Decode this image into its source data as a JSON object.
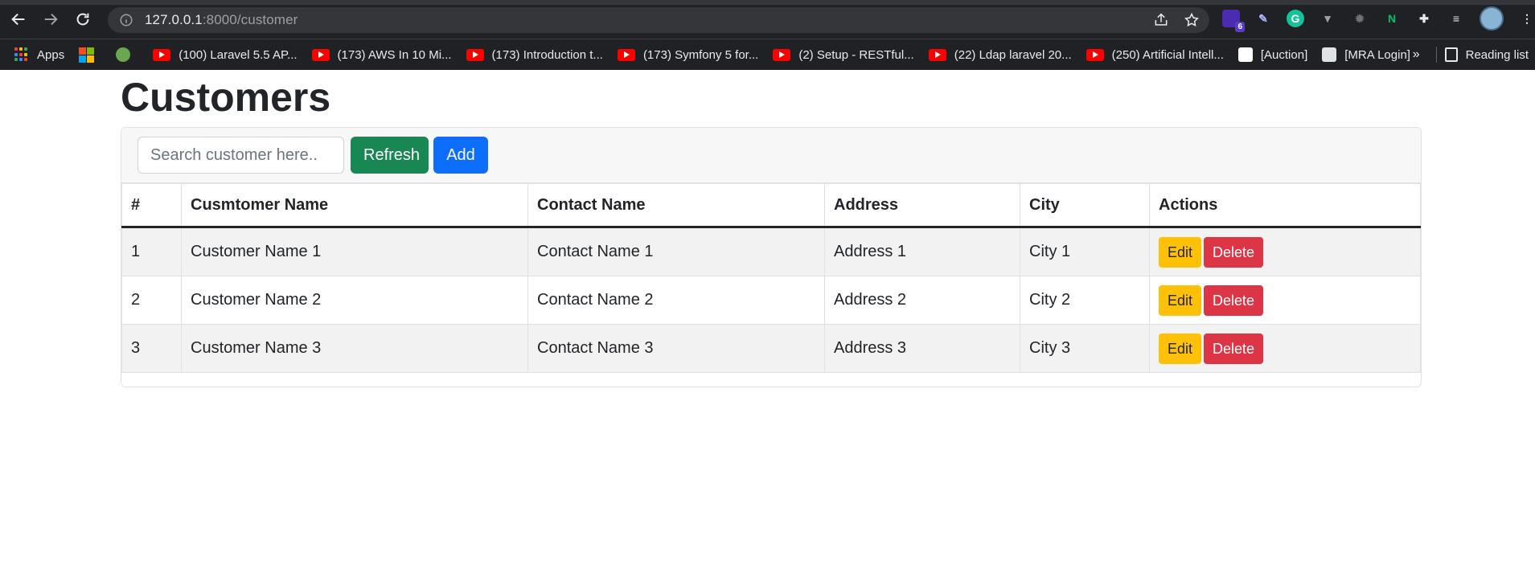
{
  "browser": {
    "url_host": "127.0.0.1",
    "url_path": ":8000/customer",
    "extension_badge": "6",
    "bookmarks": [
      {
        "label": "Apps",
        "icon": "apps-grid-icon"
      },
      {
        "label": "",
        "icon": "microsoft-icon"
      },
      {
        "label": "",
        "icon": "plant-icon"
      },
      {
        "label": "(100) Laravel 5.5 AP...",
        "icon": "youtube-icon"
      },
      {
        "label": "(173) AWS In 10 Mi...",
        "icon": "youtube-icon"
      },
      {
        "label": "(173) Introduction t...",
        "icon": "youtube-icon"
      },
      {
        "label": "(173) Symfony 5 for...",
        "icon": "youtube-icon"
      },
      {
        "label": "(2) Setup - RESTful...",
        "icon": "youtube-icon"
      },
      {
        "label": "(22) Ldap laravel 20...",
        "icon": "youtube-icon"
      },
      {
        "label": "(250) Artificial Intell...",
        "icon": "youtube-icon"
      },
      {
        "label": "[Auction]",
        "icon": "auction-icon"
      },
      {
        "label": "[MRA Login]",
        "icon": "mra-icon"
      }
    ],
    "more_bookmarks": "»",
    "reading_list": "Reading list"
  },
  "page": {
    "title": "Customers",
    "search_placeholder": "Search customer here..",
    "refresh_label": "Refresh",
    "add_label": "Add"
  },
  "table": {
    "headers": [
      "#",
      "Cusmtomer Name",
      "Contact Name",
      "Address",
      "City",
      "Actions"
    ],
    "rows": [
      {
        "id": "1",
        "customer": "Customer Name 1",
        "contact": "Contact Name 1",
        "address": "Address 1",
        "city": "City 1"
      },
      {
        "id": "2",
        "customer": "Customer Name 2",
        "contact": "Contact Name 2",
        "address": "Address 2",
        "city": "City 2"
      },
      {
        "id": "3",
        "customer": "Customer Name 3",
        "contact": "Contact Name 3",
        "address": "Address 3",
        "city": "City 3"
      }
    ],
    "edit_label": "Edit",
    "delete_label": "Delete"
  },
  "colors": {
    "refresh": "#198754",
    "add": "#0d6efd",
    "edit": "#ffc107",
    "delete": "#dc3545"
  }
}
